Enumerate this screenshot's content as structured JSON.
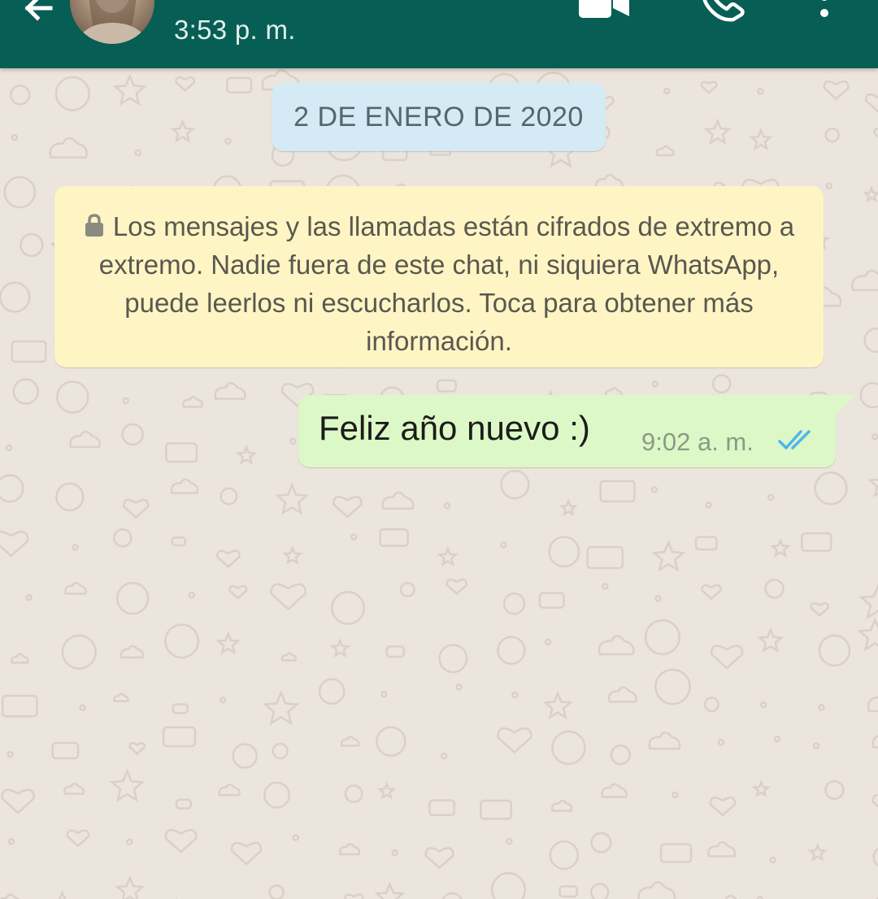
{
  "header": {
    "last_seen": "3:53 p. m.",
    "back_icon": "arrow-back-icon",
    "video_icon": "videocam-icon",
    "call_icon": "phone-icon",
    "menu_icon": "more-vert-icon",
    "color": "#075e54"
  },
  "chat": {
    "date_chip": "2 DE ENERO DE 2020",
    "encryption_notice": "Los mensajes y las llamadas están cifrados de extremo a extremo. Nadie fuera de este chat, ni siquiera WhatsApp, puede leerlos ni escucharlos. Toca para obtener más información.",
    "background_color": "#ece5dd",
    "messages": [
      {
        "direction": "outgoing",
        "text": "Feliz año nuevo :)",
        "time": "9:02 a. m.",
        "status": "read",
        "status_icon": "double-check-icon",
        "bubble_color": "#dcf8c6"
      }
    ]
  }
}
